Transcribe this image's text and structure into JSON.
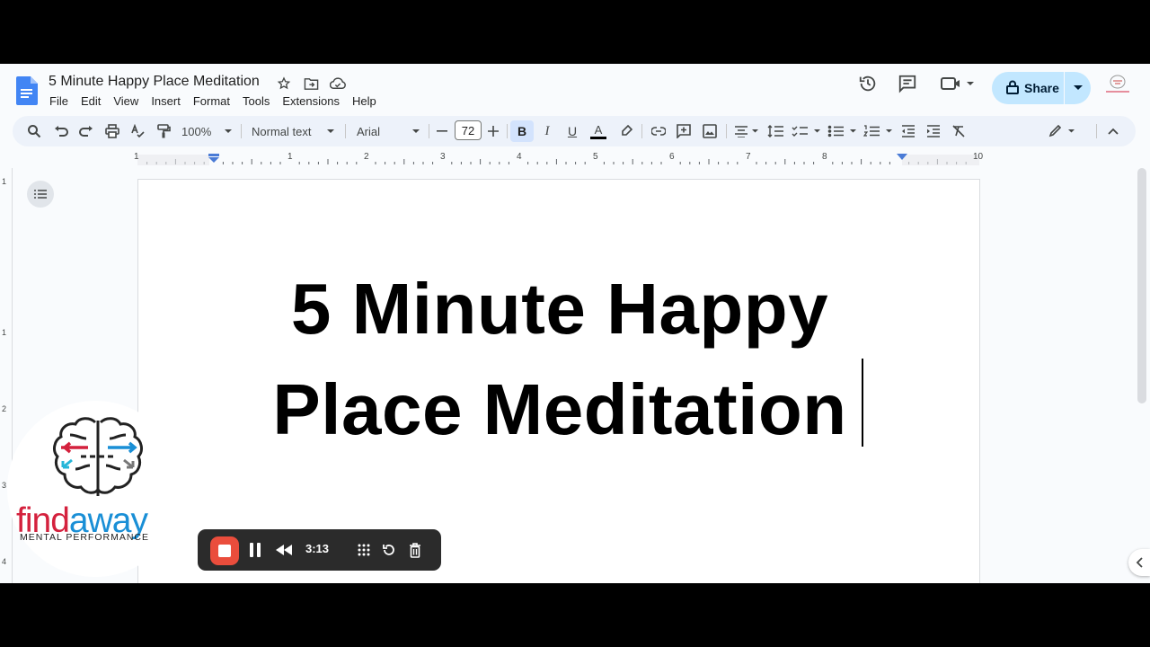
{
  "document": {
    "title": "5 Minute Happy Place Meditation",
    "heading_line1": "5 Minute Happy",
    "heading_line2": "Place Meditation"
  },
  "menu": [
    "File",
    "Edit",
    "View",
    "Insert",
    "Format",
    "Tools",
    "Extensions",
    "Help"
  ],
  "header": {
    "share_label": "Share"
  },
  "toolbar": {
    "zoom": "100%",
    "style": "Normal text",
    "font": "Arial",
    "font_size": "72"
  },
  "ruler": {
    "numbers": [
      "1",
      "1",
      "2",
      "3",
      "4",
      "5",
      "6",
      "7",
      "8",
      "9",
      "10"
    ]
  },
  "vruler": {
    "numbers": [
      "1",
      "1",
      "2",
      "3",
      "4"
    ]
  },
  "brand": {
    "word_main": "find",
    "word_accent": "a",
    "word_end": "way",
    "subtitle": "MENTAL PERFORMANCE"
  },
  "recorder": {
    "time": "3:13"
  },
  "colors": {
    "share_bg": "#c2e7ff",
    "toolbar_bg": "#edf2fa",
    "record_red": "#ea4d3c",
    "brand_red": "#d4213d",
    "brand_blue": "#1a8fd6"
  }
}
